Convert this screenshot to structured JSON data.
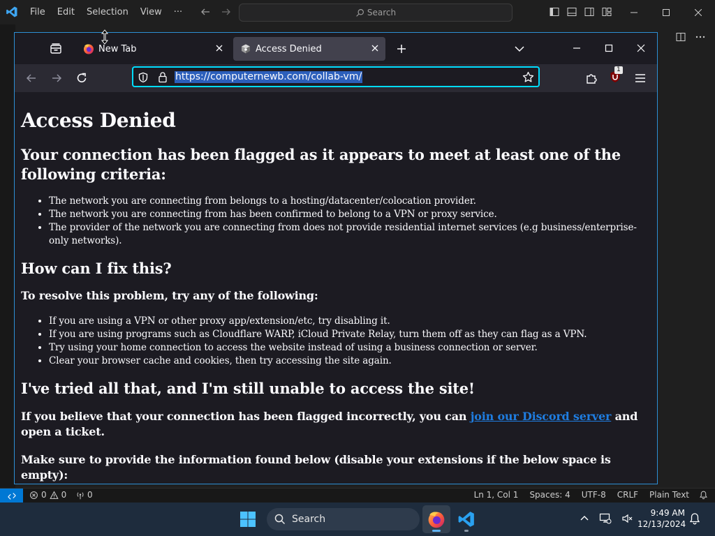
{
  "vscode": {
    "menu": [
      "File",
      "Edit",
      "Selection",
      "View",
      "···"
    ],
    "search_placeholder": "Search",
    "status": {
      "errors": "0",
      "warnings": "0",
      "ports": "0",
      "position": "Ln 1, Col 1",
      "spaces": "Spaces: 4",
      "encoding": "UTF-8",
      "eol": "CRLF",
      "language": "Plain Text"
    }
  },
  "firefox": {
    "tabs": [
      {
        "label": "New Tab",
        "active": false,
        "icon": "firefox-icon"
      },
      {
        "label": "Access Denied",
        "active": true,
        "icon": "site-icon"
      }
    ],
    "url": "https://computernewb.com/collab-vm/",
    "ublock_badge": "1",
    "page": {
      "title": "Access Denied",
      "subtitle": "Your connection has been flagged as it appears to meet at least one of the following criteria:",
      "criteria": [
        "The network you are connecting from belongs to a hosting/datacenter/colocation provider.",
        "The network you are connecting from has been confirmed to belong to a VPN or proxy service.",
        "The provider of the network you are connecting from does not provide residential internet services (e.g business/enterprise-only networks)."
      ],
      "fix_heading": "How can I fix this?",
      "fix_intro": "To resolve this problem, try any of the following:",
      "fixes": [
        "If you are using a VPN or other proxy app/extension/etc, try disabling it.",
        "If you are using programs such as Cloudflare WARP, iCloud Private Relay, turn them off as they can flag as a VPN.",
        "Try using your home connection to access the website instead of using a business connection or server.",
        "Clear your browser cache and cookies, then try accessing the site again."
      ],
      "still_heading": "I've tried all that, and I'm still unable to access the site!",
      "discord_before": "If you believe that your connection has been flagged incorrectly, you can ",
      "discord_link": "join our Discord server",
      "discord_after": " and open a ticket.",
      "cut_text": "Make sure to provide the information found below (disable your extensions if the below space is empty):"
    }
  },
  "taskbar": {
    "search_label": "Search",
    "time": "9:49 AM",
    "date": "12/13/2024"
  },
  "colors": {
    "vscode_accent": "#0078d4",
    "firefox_focus": "#00ddff",
    "link": "#1f7de0",
    "taskbar_bg": "#1e2c3d"
  }
}
